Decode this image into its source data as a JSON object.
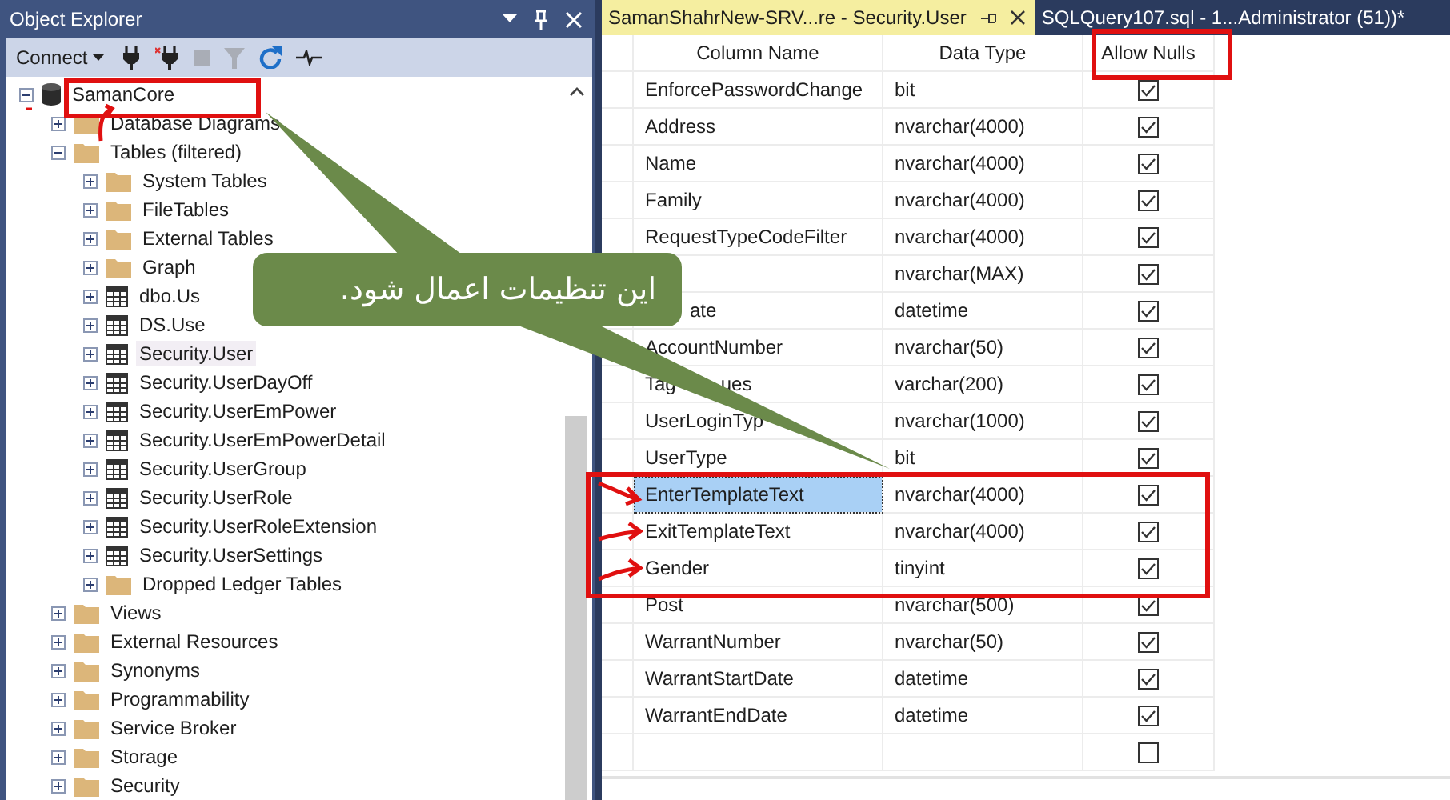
{
  "object_explorer": {
    "title": "Object Explorer",
    "toolbar": {
      "connect_label": "Connect"
    },
    "tree": [
      {
        "label": "SamanCore",
        "kind": "database",
        "expanded": true,
        "selected": false,
        "children": [
          {
            "label": "Database Diagrams",
            "kind": "folder",
            "expanded": false,
            "selected": false
          },
          {
            "label": "Tables (filtered)",
            "kind": "folder",
            "expanded": true,
            "selected": false,
            "children": [
              {
                "label": "System Tables",
                "kind": "folder",
                "expanded": false,
                "selected": false
              },
              {
                "label": "FileTables",
                "kind": "folder",
                "expanded": false,
                "selected": false
              },
              {
                "label": "External Tables",
                "kind": "folder",
                "expanded": false,
                "selected": false
              },
              {
                "label": "Graph",
                "kind": "folder",
                "expanded": false,
                "selected": false
              },
              {
                "label": "dbo.Us",
                "kind": "table",
                "expanded": false,
                "selected": false
              },
              {
                "label": "DS.Use",
                "kind": "table",
                "expanded": false,
                "selected": false
              },
              {
                "label": "Security.User",
                "kind": "table",
                "expanded": false,
                "selected": true
              },
              {
                "label": "Security.UserDayOff",
                "kind": "table",
                "expanded": false,
                "selected": false
              },
              {
                "label": "Security.UserEmPower",
                "kind": "table",
                "expanded": false,
                "selected": false
              },
              {
                "label": "Security.UserEmPowerDetail",
                "kind": "table",
                "expanded": false,
                "selected": false
              },
              {
                "label": "Security.UserGroup",
                "kind": "table",
                "expanded": false,
                "selected": false
              },
              {
                "label": "Security.UserRole",
                "kind": "table",
                "expanded": false,
                "selected": false
              },
              {
                "label": "Security.UserRoleExtension",
                "kind": "table",
                "expanded": false,
                "selected": false
              },
              {
                "label": "Security.UserSettings",
                "kind": "table",
                "expanded": false,
                "selected": false
              },
              {
                "label": "Dropped Ledger Tables",
                "kind": "folder",
                "expanded": false,
                "selected": false
              }
            ]
          },
          {
            "label": "Views",
            "kind": "folder",
            "expanded": false,
            "selected": false
          },
          {
            "label": "External Resources",
            "kind": "folder",
            "expanded": false,
            "selected": false
          },
          {
            "label": "Synonyms",
            "kind": "folder",
            "expanded": false,
            "selected": false
          },
          {
            "label": "Programmability",
            "kind": "folder",
            "expanded": false,
            "selected": false
          },
          {
            "label": "Service Broker",
            "kind": "folder",
            "expanded": false,
            "selected": false
          },
          {
            "label": "Storage",
            "kind": "folder",
            "expanded": false,
            "selected": false
          },
          {
            "label": "Security",
            "kind": "folder",
            "expanded": false,
            "selected": false
          }
        ]
      }
    ]
  },
  "document_tabs": [
    {
      "label": "SamanShahrNew-SRV...re - Security.User",
      "selected": true
    },
    {
      "label": "SQLQuery107.sql - 1...Administrator (51))*",
      "selected": false
    }
  ],
  "grid": {
    "columns": [
      "Column Name",
      "Data Type",
      "Allow Nulls"
    ],
    "rows": [
      {
        "name": "EnforcePasswordChange",
        "type": "bit",
        "allow_nulls": true,
        "selected": false
      },
      {
        "name": "Address",
        "type": "nvarchar(4000)",
        "allow_nulls": true,
        "selected": false
      },
      {
        "name": "Name",
        "type": "nvarchar(4000)",
        "allow_nulls": true,
        "selected": false
      },
      {
        "name": "Family",
        "type": "nvarchar(4000)",
        "allow_nulls": true,
        "selected": false
      },
      {
        "name": "RequestTypeCodeFilter",
        "type": "nvarchar(4000)",
        "allow_nulls": true,
        "selected": false
      },
      {
        "type": "nvarchar(MAX)",
        "allow_nulls": true,
        "selected": false
      },
      {
        "name_tail": "ate",
        "type": "datetime",
        "allow_nulls": true,
        "selected": false
      },
      {
        "name": "AccountNumber",
        "type": "nvarchar(50)",
        "allow_nulls": true,
        "selected": false
      },
      {
        "name": "Tag",
        "name_tail": "ues",
        "type": "varchar(200)",
        "allow_nulls": true,
        "selected": false
      },
      {
        "name": "UserLoginTyp",
        "type": "nvarchar(1000)",
        "allow_nulls": true,
        "selected": false
      },
      {
        "name": "UserType",
        "type": "bit",
        "allow_nulls": true,
        "selected": false
      },
      {
        "name": "EnterTemplateText",
        "type": "nvarchar(4000)",
        "allow_nulls": true,
        "selected": true
      },
      {
        "name": "ExitTemplateText",
        "type": "nvarchar(4000)",
        "allow_nulls": true,
        "selected": false
      },
      {
        "name": "Gender",
        "type": "tinyint",
        "allow_nulls": true,
        "selected": false
      },
      {
        "name": "Post",
        "type": "nvarchar(500)",
        "allow_nulls": true,
        "selected": false
      },
      {
        "name": "WarrantNumber",
        "type": "nvarchar(50)",
        "allow_nulls": true,
        "selected": false
      },
      {
        "name": "WarrantStartDate",
        "type": "datetime",
        "allow_nulls": true,
        "selected": false
      },
      {
        "name": "WarrantEndDate",
        "type": "datetime",
        "allow_nulls": true,
        "selected": false
      },
      {
        "allow_nulls": false,
        "selected": false
      }
    ]
  },
  "annotation": {
    "callout_text": "این تنظیمات اعمال شود."
  }
}
